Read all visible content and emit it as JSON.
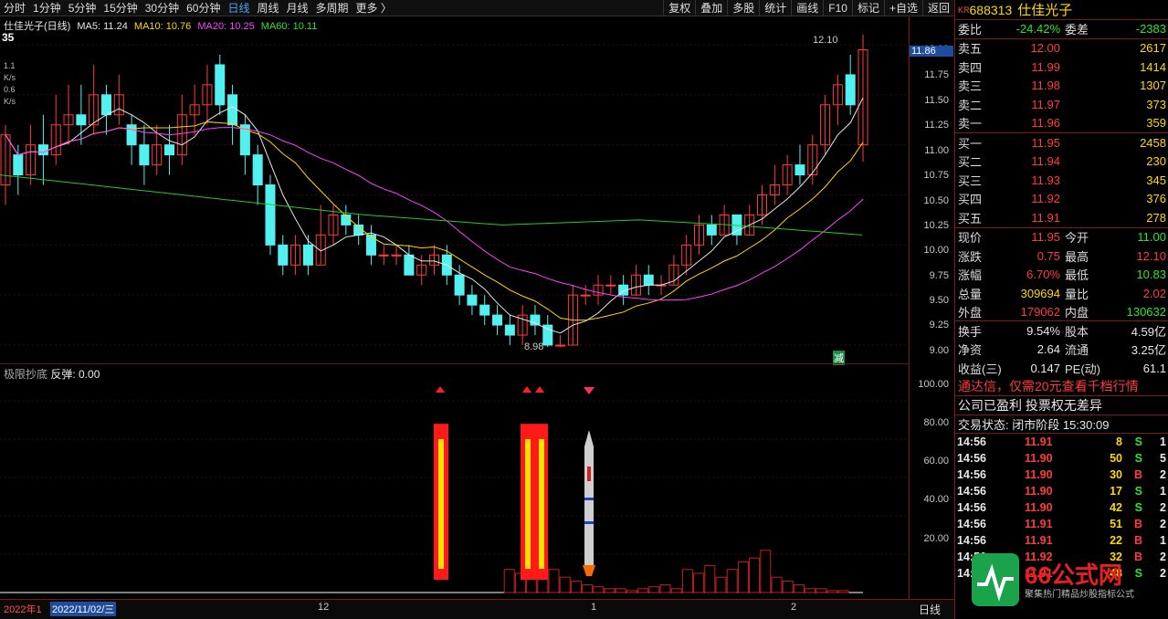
{
  "toolbar": {
    "periods": [
      "分时",
      "1分钟",
      "5分钟",
      "15分钟",
      "30分钟",
      "60分钟",
      "日线",
      "周线",
      "月线",
      "多周期",
      "更多 〉"
    ],
    "tools": [
      "复权",
      "叠加",
      "多股",
      "统计",
      "画线",
      "F10",
      "标记",
      "+自选",
      "返回"
    ]
  },
  "legend": {
    "name": "仕佳光子(日线)",
    "ma5": "MA5: 11.24",
    "ma10": "MA10: 10.76",
    "ma20": "MA20: 10.25",
    "ma60": "MA60: 10.11",
    "badge": "35",
    "speed1": "1.1",
    "speed2": "0.6",
    "speed_unit": "K/s"
  },
  "price_axis": [
    "12.00",
    "11.75",
    "11.50",
    "11.25",
    "11.00",
    "10.75",
    "10.50",
    "10.25",
    "10.00",
    "9.75",
    "9.50",
    "9.25",
    "9.00"
  ],
  "axis_badge": "11.86",
  "annotations": {
    "high": "12.10",
    "low": "8.98",
    "reduce": "减"
  },
  "indicator": {
    "title": "极限抄底",
    "sub": "反弹: 0.00",
    "axis": [
      "100.00",
      "80.00",
      "60.00",
      "40.00",
      "20.00"
    ]
  },
  "bottom": {
    "start": "2022年1",
    "date": "2022/11/02/三",
    "m12": "12",
    "m1": "1",
    "m2": "2",
    "period": "日线"
  },
  "quote": {
    "code": "688313",
    "name": "仕佳光子",
    "code_prefix": "KR",
    "ratio_label": "委比",
    "ratio": "-24.42%",
    "diff_label": "委差",
    "diff": "-2383",
    "sells": [
      [
        "卖五",
        "12.00",
        "2617"
      ],
      [
        "卖四",
        "11.99",
        "1414"
      ],
      [
        "卖三",
        "11.98",
        "1307"
      ],
      [
        "卖二",
        "11.97",
        "373"
      ],
      [
        "卖一",
        "11.96",
        "359"
      ]
    ],
    "buys": [
      [
        "买一",
        "11.95",
        "2458"
      ],
      [
        "买二",
        "11.94",
        "230"
      ],
      [
        "买三",
        "11.93",
        "345"
      ],
      [
        "买四",
        "11.92",
        "376"
      ],
      [
        "买五",
        "11.91",
        "278"
      ]
    ],
    "stats": [
      [
        "现价",
        "11.95",
        "今开",
        "11.00"
      ],
      [
        "涨跌",
        "0.75",
        "最高",
        "12.10"
      ],
      [
        "涨幅",
        "6.70%",
        "最低",
        "10.83"
      ],
      [
        "总量",
        "309694",
        "量比",
        "2.02"
      ],
      [
        "外盘",
        "179062",
        "内盘",
        "130632"
      ],
      [
        "换手",
        "9.54%",
        "股本",
        "4.59亿"
      ],
      [
        "净资",
        "2.64",
        "流通",
        "3.25亿"
      ],
      [
        "收益(三)",
        "0.147",
        "PE(动)",
        "61.1"
      ]
    ],
    "promo": "通达信，仅需20元查看千档行情",
    "notice": "公司已盈利 投票权无差异",
    "status": "交易状态: 闭市阶段 15:30:09",
    "ticks": [
      [
        "14:56",
        "11.91",
        "8",
        "S",
        "1"
      ],
      [
        "14:56",
        "11.90",
        "50",
        "S",
        "5"
      ],
      [
        "14:56",
        "11.90",
        "30",
        "B",
        "2"
      ],
      [
        "14:56",
        "11.90",
        "17",
        "S",
        "1"
      ],
      [
        "14:56",
        "11.90",
        "42",
        "S",
        "2"
      ],
      [
        "14:56",
        "11.91",
        "51",
        "B",
        "2"
      ],
      [
        "14:56",
        "11.91",
        "22",
        "B",
        "1"
      ],
      [
        "14:56",
        "11.92",
        "32",
        "B",
        "2"
      ],
      [
        "14:56",
        "11.91",
        "48",
        "S",
        "2"
      ]
    ],
    "watermark": "66公式网",
    "watermark_sub": "聚集热门精品炒股指标公式"
  },
  "colors": {
    "up": "#ff3b3b",
    "down": "#53f0f0",
    "ma5": "#e8e8e8",
    "ma10": "#ffd400",
    "ma20": "#ff40ff",
    "ma60": "#22cc22"
  }
}
